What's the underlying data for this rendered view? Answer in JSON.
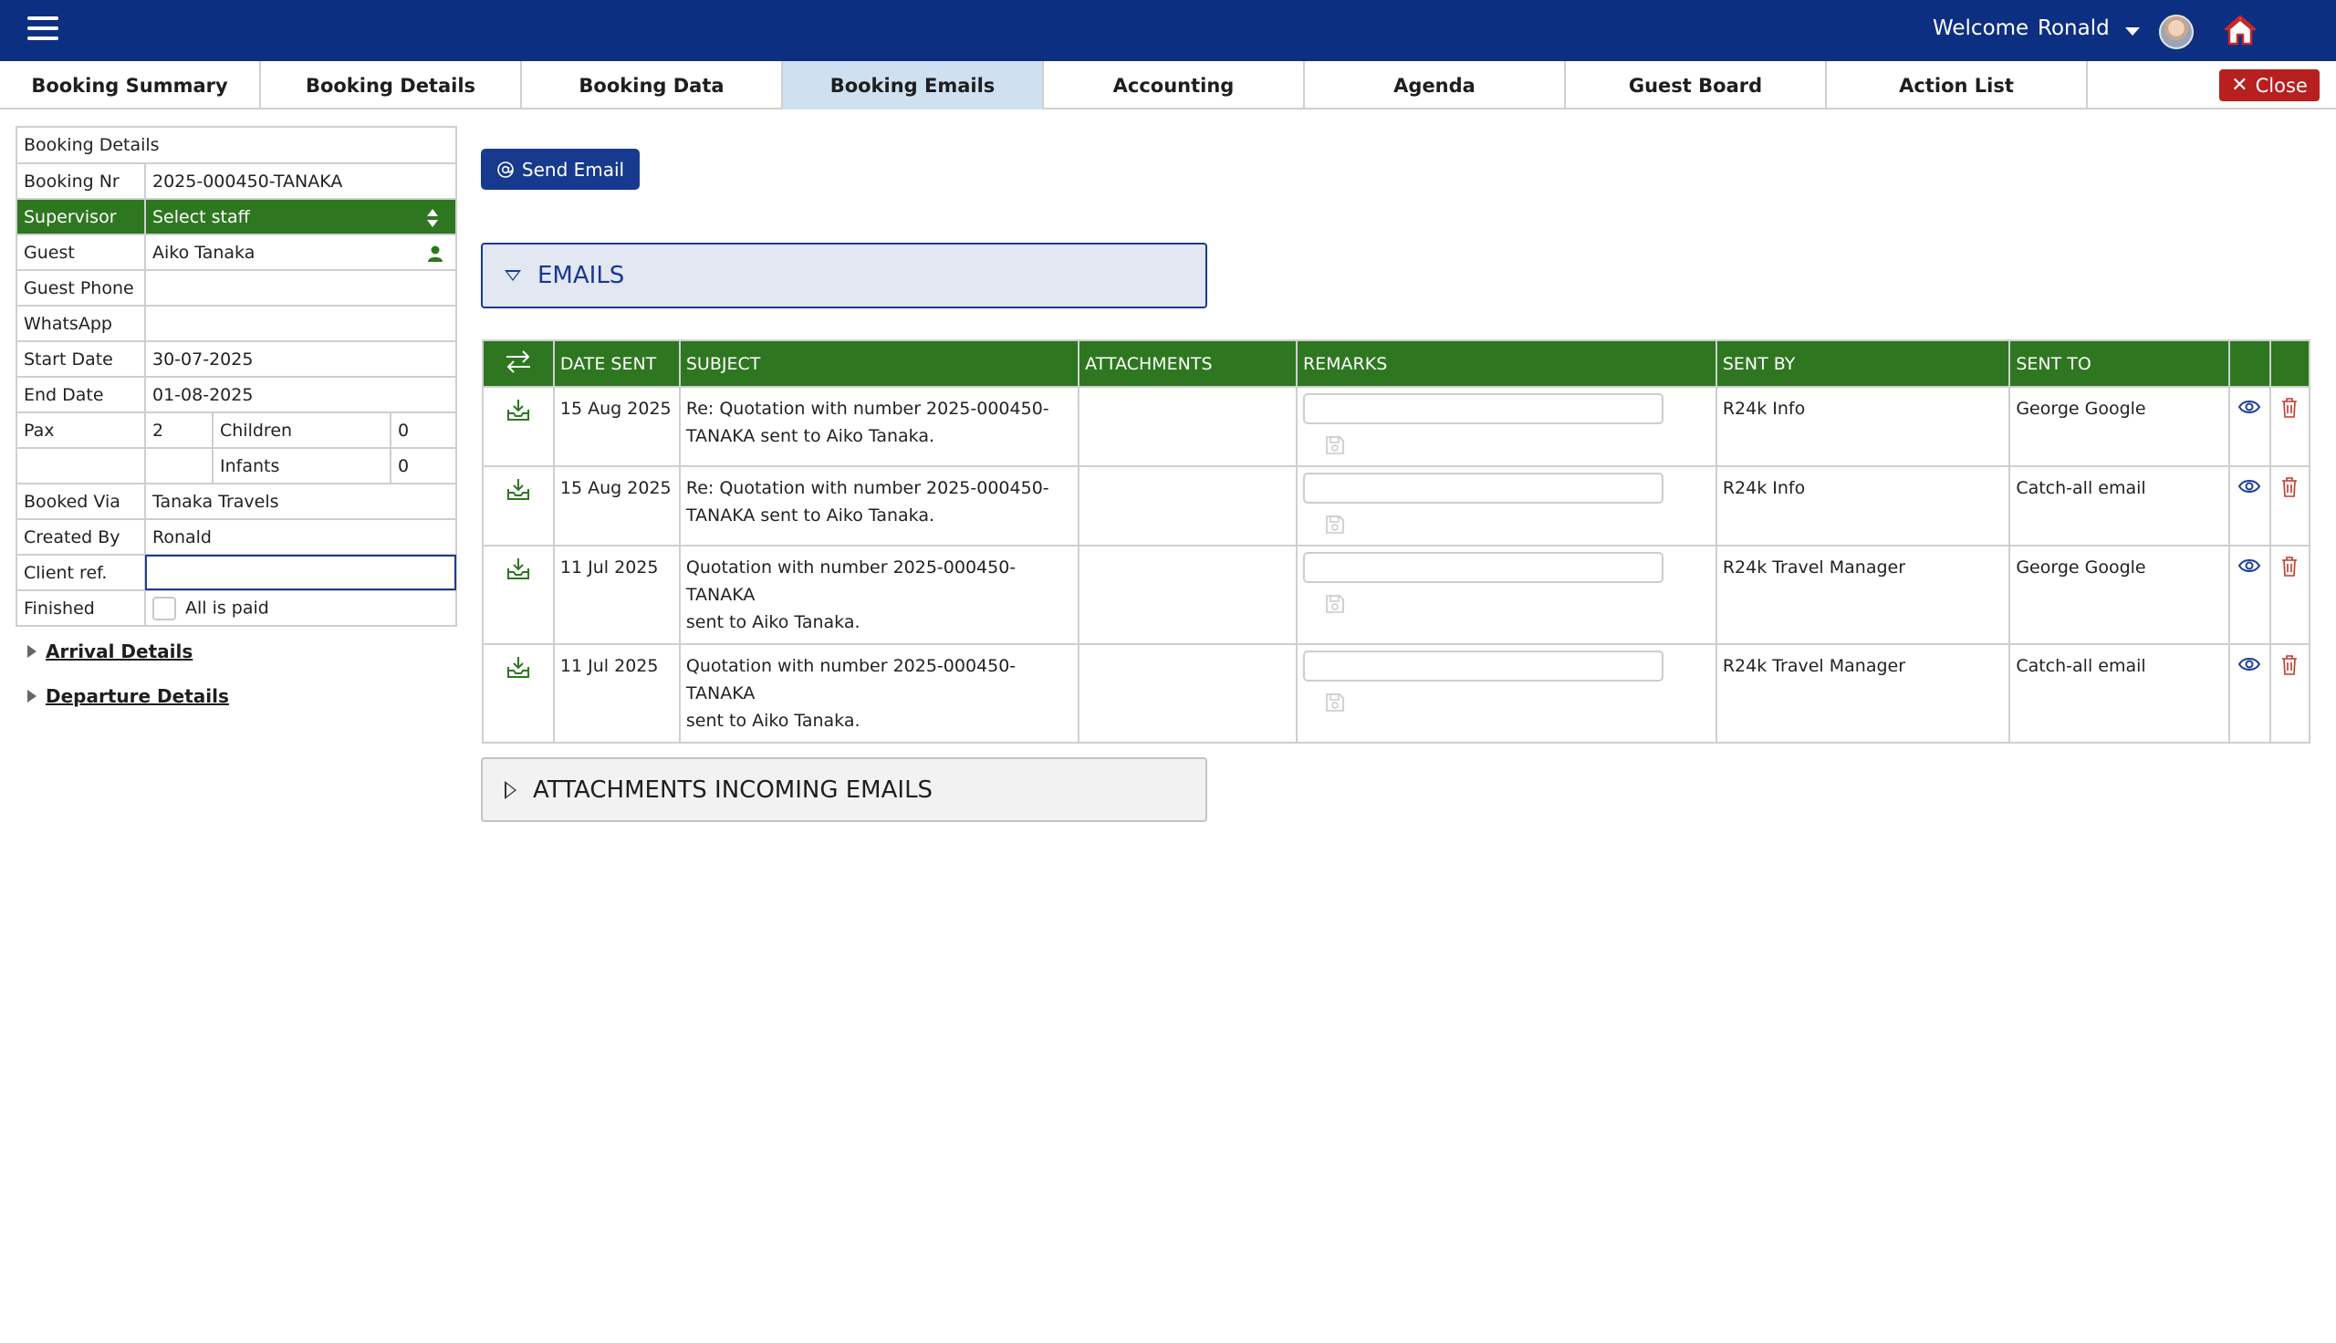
{
  "header": {
    "welcome": "Welcome",
    "user_name": "Ronald"
  },
  "tabs": [
    {
      "label": "Booking Summary"
    },
    {
      "label": "Booking Details"
    },
    {
      "label": "Booking Data"
    },
    {
      "label": "Booking Emails",
      "active": true
    },
    {
      "label": "Accounting"
    },
    {
      "label": "Agenda"
    },
    {
      "label": "Guest Board"
    },
    {
      "label": "Action List"
    }
  ],
  "close_label": "Close",
  "booking": {
    "title": "Booking Details",
    "booking_nr_label": "Booking Nr",
    "booking_nr": "2025-000450-TANAKA",
    "supervisor_label": "Supervisor",
    "supervisor": "Select staff",
    "guest_label": "Guest",
    "guest": "Aiko Tanaka",
    "guest_phone_label": "Guest Phone",
    "guest_phone": "",
    "whatsapp_label": "WhatsApp",
    "whatsapp": "",
    "start_date_label": "Start Date",
    "start_date": "30-07-2025",
    "end_date_label": "End Date",
    "end_date": "01-08-2025",
    "pax_label": "Pax",
    "pax": "2",
    "children_label": "Children",
    "children": "0",
    "infants_label": "Infants",
    "infants": "0",
    "booked_via_label": "Booked Via",
    "booked_via": "Tanaka Travels",
    "created_by_label": "Created By",
    "created_by": "Ronald",
    "client_ref_label": "Client ref.",
    "client_ref": "",
    "finished_label": "Finished",
    "all_paid_label": "All is paid"
  },
  "sections": {
    "arrival": "Arrival Details",
    "departure": "Departure Details"
  },
  "send_email_label": "Send Email",
  "emails_panel_title": "EMAILS",
  "attachments_panel_title": "ATTACHMENTS INCOMING EMAILS",
  "emails_table": {
    "columns": [
      "DATE SENT",
      "SUBJECT",
      "ATTACHMENTS",
      "REMARKS",
      "SENT BY",
      "SENT TO"
    ],
    "rows": [
      {
        "date": "15 Aug 2025",
        "subject_l1": "Re: Quotation with number 2025-000450-",
        "subject_l2": "TANAKA sent to Aiko Tanaka.",
        "attachments": "",
        "remarks": "",
        "sent_by": "R24k Info",
        "sent_to": "George Google"
      },
      {
        "date": "15 Aug 2025",
        "subject_l1": "Re: Quotation with number 2025-000450-",
        "subject_l2": "TANAKA sent to Aiko Tanaka.",
        "attachments": "",
        "remarks": "",
        "sent_by": "R24k Info",
        "sent_to": "Catch-all email"
      },
      {
        "date": "11 Jul 2025",
        "subject_l1": "Quotation with number 2025-000450-TANAKA",
        "subject_l2": "sent to Aiko Tanaka.",
        "attachments": "",
        "remarks": "",
        "sent_by": "R24k Travel Manager",
        "sent_to": "George Google"
      },
      {
        "date": "11 Jul 2025",
        "subject_l1": "Quotation with number 2025-000450-TANAKA",
        "subject_l2": "sent to Aiko Tanaka.",
        "attachments": "",
        "remarks": "",
        "sent_by": "R24k Travel Manager",
        "sent_to": "Catch-all email"
      }
    ]
  },
  "colors": {
    "topbar": "#0d2f82",
    "green": "#2e7720",
    "close_red": "#b81f1f",
    "active_tab": "#cfe0f0"
  },
  "icons": [
    "menu-icon",
    "chevron-down-icon",
    "avatar",
    "home-icon",
    "close-icon",
    "sort-arrows-icon",
    "person-icon",
    "at-icon",
    "swap-icon",
    "inbox-download-icon",
    "save-icon",
    "eye-icon",
    "trash-icon"
  ]
}
